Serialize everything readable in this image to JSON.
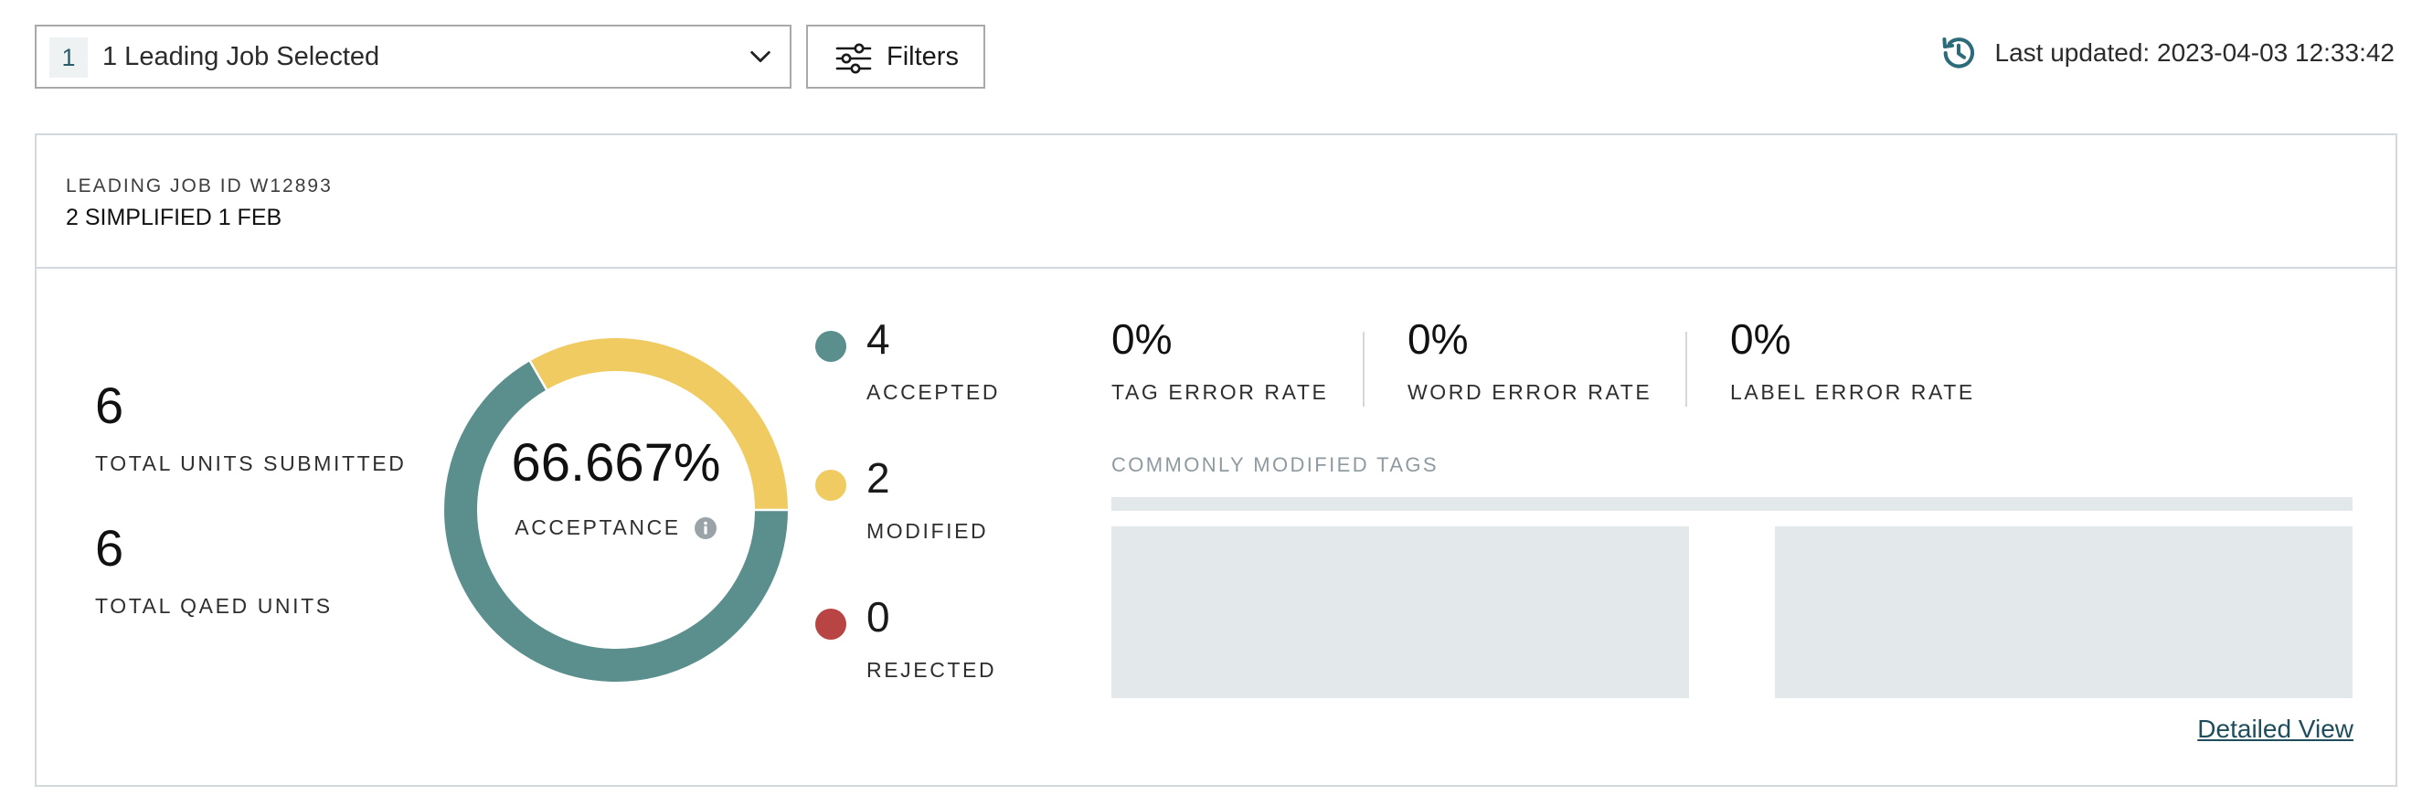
{
  "job_selector": {
    "count": "1",
    "label": "1 Leading Job Selected"
  },
  "filters": {
    "label": "Filters"
  },
  "last_updated": {
    "text": "Last updated: 2023-04-03 12:33:42"
  },
  "job": {
    "id_label": "LEADING JOB ID W12893",
    "name": "2 SIMPLIFIED 1 FEB"
  },
  "totals": {
    "submitted_value": "6",
    "submitted_label": "TOTAL UNITS SUBMITTED",
    "qaed_value": "6",
    "qaed_label": "TOTAL QAED UNITS"
  },
  "acceptance": {
    "value": "66.667%",
    "label": "ACCEPTANCE",
    "segments": [
      {
        "name": "accepted",
        "value": 4,
        "color": "#5a8f8e"
      },
      {
        "name": "modified",
        "value": 2,
        "color": "#efcb62"
      },
      {
        "name": "rejected",
        "value": 0,
        "color": "#b84444"
      }
    ]
  },
  "legend": {
    "accepted_value": "4",
    "accepted_label": "ACCEPTED",
    "modified_value": "2",
    "modified_label": "MODIFIED",
    "rejected_value": "0",
    "rejected_label": "REJECTED"
  },
  "error_rates": {
    "tag_value": "0%",
    "tag_label": "TAG ERROR RATE",
    "word_value": "0%",
    "word_label": "WORD ERROR RATE",
    "label_value": "0%",
    "label_label": "LABEL ERROR RATE"
  },
  "tags": {
    "title": "COMMONLY MODIFIED TAGS"
  },
  "detailed_view": {
    "label": "Detailed View"
  },
  "colors": {
    "accent": "#5a8f8e",
    "modified": "#efcb62",
    "rejected": "#b84444",
    "icon": "#2c6b7a",
    "placeholder": "#e3e8ea"
  },
  "icons": {
    "dropdown": "chevron-down-icon",
    "filters": "sliders-icon",
    "last_updated": "history-icon",
    "acceptance_info": "info-icon"
  }
}
